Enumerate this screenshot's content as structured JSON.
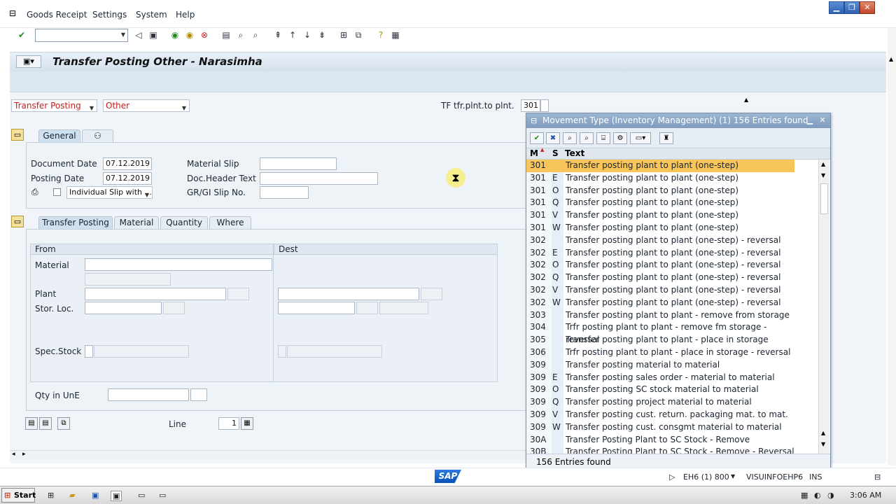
{
  "menu": [
    "Goods Receipt",
    "Settings",
    "System",
    "Help"
  ],
  "screen_title": "Transfer Posting Other - Narasimha",
  "header_row": {
    "action_dropdown": "Transfer Posting",
    "ref_dropdown": "Other",
    "mvt_label": "TF tfr.plnt.to plnt.",
    "mvt_value": "301"
  },
  "general_tab": {
    "tab_label": "General",
    "document_date_label": "Document Date",
    "document_date": "07.12.2019",
    "posting_date_label": "Posting Date",
    "posting_date": "07.12.2019",
    "slip_option": "Individual Slip with ...",
    "material_slip_label": "Material Slip",
    "doc_header_label": "Doc.Header Text",
    "grgi_slip_label": "GR/GI Slip No."
  },
  "item_tabs": [
    "Transfer Posting",
    "Material",
    "Quantity",
    "Where"
  ],
  "item_detail": {
    "from_header": "From",
    "dest_header": "Dest",
    "material_label": "Material",
    "plant_label": "Plant",
    "stor_loc_label": "Stor. Loc.",
    "spec_stock_label": "Spec.Stock",
    "qty_label": "Qty in UnE",
    "line_label": "Line",
    "line_value": "1"
  },
  "popup": {
    "title": "Movement Type (Inventory Management) (1)  156 Entries found",
    "col_m": "M",
    "col_s": "S",
    "col_text": "Text",
    "status": "156 Entries found",
    "rows": [
      {
        "m": "301",
        "s": "",
        "text": "Transfer posting plant to plant (one-step)"
      },
      {
        "m": "301",
        "s": "E",
        "text": "Transfer posting plant to plant (one-step)"
      },
      {
        "m": "301",
        "s": "O",
        "text": "Transfer posting plant to plant (one-step)"
      },
      {
        "m": "301",
        "s": "Q",
        "text": "Transfer posting plant to plant (one-step)"
      },
      {
        "m": "301",
        "s": "V",
        "text": "Transfer posting plant to plant (one-step)"
      },
      {
        "m": "301",
        "s": "W",
        "text": "Transfer posting plant to plant (one-step)"
      },
      {
        "m": "302",
        "s": "",
        "text": "Transfer posting plant to plant (one-step) - reversal"
      },
      {
        "m": "302",
        "s": "E",
        "text": "Transfer posting plant to plant (one-step) - reversal"
      },
      {
        "m": "302",
        "s": "O",
        "text": "Transfer posting plant to plant (one-step) - reversal"
      },
      {
        "m": "302",
        "s": "Q",
        "text": "Transfer posting plant to plant (one-step) - reversal"
      },
      {
        "m": "302",
        "s": "V",
        "text": "Transfer posting plant to plant (one-step) - reversal"
      },
      {
        "m": "302",
        "s": "W",
        "text": "Transfer posting plant to plant (one-step) - reversal"
      },
      {
        "m": "303",
        "s": "",
        "text": "Transfer posting plant to plant - remove from storage"
      },
      {
        "m": "304",
        "s": "",
        "text": "Trfr posting plant to plant - remove fm storage - reversal"
      },
      {
        "m": "305",
        "s": "",
        "text": "Transfer posting plant to plant - place in storage"
      },
      {
        "m": "306",
        "s": "",
        "text": "Trfr posting plant to plant - place in storage - reversal"
      },
      {
        "m": "309",
        "s": "",
        "text": "Transfer posting material to material"
      },
      {
        "m": "309",
        "s": "E",
        "text": "Transfer posting sales order - material to material"
      },
      {
        "m": "309",
        "s": "O",
        "text": "Transfer posting SC stock material to material"
      },
      {
        "m": "309",
        "s": "Q",
        "text": "Transfer posting project material to material"
      },
      {
        "m": "309",
        "s": "V",
        "text": "Transfer posting cust. return. packaging mat. to mat."
      },
      {
        "m": "309",
        "s": "W",
        "text": "Transfer posting cust. consgmt material to material"
      },
      {
        "m": "30A",
        "s": "",
        "text": "Transfer Posting Plant to SC Stock - Remove"
      },
      {
        "m": "30B",
        "s": "",
        "text": "Transfer Posting Plant to SC Stock - Remove - Reversal"
      }
    ],
    "selected_index": 0
  },
  "status_bar": {
    "system": "EH6 (1) 800",
    "server": "VISUINFOEHP6",
    "mode": "INS"
  },
  "taskbar": {
    "start": "Start",
    "clock": "3:06 AM"
  },
  "logo_text": "SAP",
  "colors": {
    "selected_row": "#f7c55a",
    "error_text": "#c42020",
    "title_blue": "#7f9cbd"
  }
}
